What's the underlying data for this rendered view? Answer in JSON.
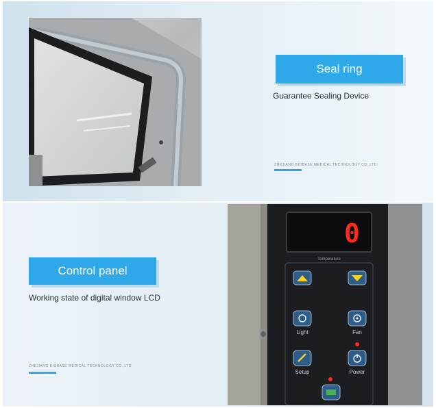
{
  "sections": [
    {
      "title": "Seal ring",
      "subtitle": "Guarantee Sealing Device",
      "fine_print": "ZHEJIANG BIOBASE MEDICAL TECHNOLOGY CO.,LTD"
    },
    {
      "title": "Control panel",
      "subtitle": "Working state of digital window LCD",
      "fine_print": "ZHEJIANG BIOBASE MEDICAL TECHNOLOGY CO.,LTD",
      "display": {
        "digit": "0",
        "label": "Temperature"
      },
      "keys": [
        {
          "label": "",
          "icon": "up-arrow-icon"
        },
        {
          "label": "",
          "icon": "down-arrow-icon"
        },
        {
          "label": "Light",
          "icon": "light-icon"
        },
        {
          "label": "Fan",
          "icon": "fan-icon"
        },
        {
          "label": "Setup",
          "icon": "setup-icon"
        },
        {
          "label": "Power",
          "icon": "power-icon"
        }
      ]
    }
  ],
  "colors": {
    "accent": "#2ea8e8",
    "led": "#ff2a1a",
    "panel_bg": "#1b1d20"
  }
}
